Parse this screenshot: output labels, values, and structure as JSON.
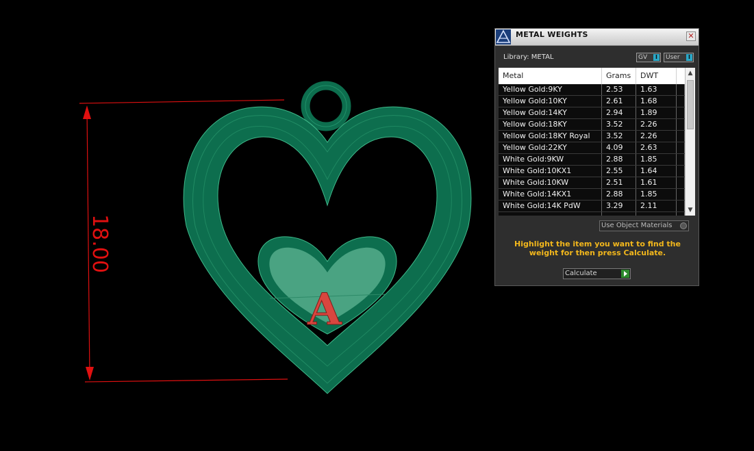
{
  "viewport": {
    "dimension_label": "18.00",
    "letter": "A",
    "colors": {
      "background": "#000000",
      "model": "#0d6e4e",
      "model_inner": "#1f8c63",
      "dimension": "#e01010",
      "letter": "#d9463f"
    }
  },
  "panel": {
    "title": "METAL WEIGHTS",
    "close_label": "✕",
    "library_label": "Library: METAL",
    "gv_label": "GV",
    "user_label": "User",
    "columns": [
      "Metal",
      "Grams",
      "DWT"
    ],
    "rows": [
      {
        "metal": "Yellow Gold:9KY",
        "grams": "2.53",
        "dwt": "1.63"
      },
      {
        "metal": "Yellow Gold:10KY",
        "grams": "2.61",
        "dwt": "1.68"
      },
      {
        "metal": "Yellow Gold:14KY",
        "grams": "2.94",
        "dwt": "1.89"
      },
      {
        "metal": "Yellow Gold:18KY",
        "grams": "3.52",
        "dwt": "2.26"
      },
      {
        "metal": "Yellow Gold:18KY Royal",
        "grams": "3.52",
        "dwt": "2.26"
      },
      {
        "metal": "Yellow Gold:22KY",
        "grams": "4.09",
        "dwt": "2.63"
      },
      {
        "metal": "White Gold:9KW",
        "grams": "2.88",
        "dwt": "1.85"
      },
      {
        "metal": "White Gold:10KX1",
        "grams": "2.55",
        "dwt": "1.64"
      },
      {
        "metal": "White Gold:10KW",
        "grams": "2.51",
        "dwt": "1.61"
      },
      {
        "metal": "White Gold:14KX1",
        "grams": "2.88",
        "dwt": "1.85"
      },
      {
        "metal": "White Gold:14K PdW",
        "grams": "3.29",
        "dwt": "2.11"
      }
    ],
    "use_object_materials_label": "Use Object Materials",
    "hint_text": "Highlight the item you want to find the weight for then press Calculate.",
    "calculate_label": "Calculate",
    "colors": {
      "hint": "#f2b71c",
      "toggle_knob": "#2aa8c8",
      "calculate_go": "#2d8a2d"
    }
  }
}
